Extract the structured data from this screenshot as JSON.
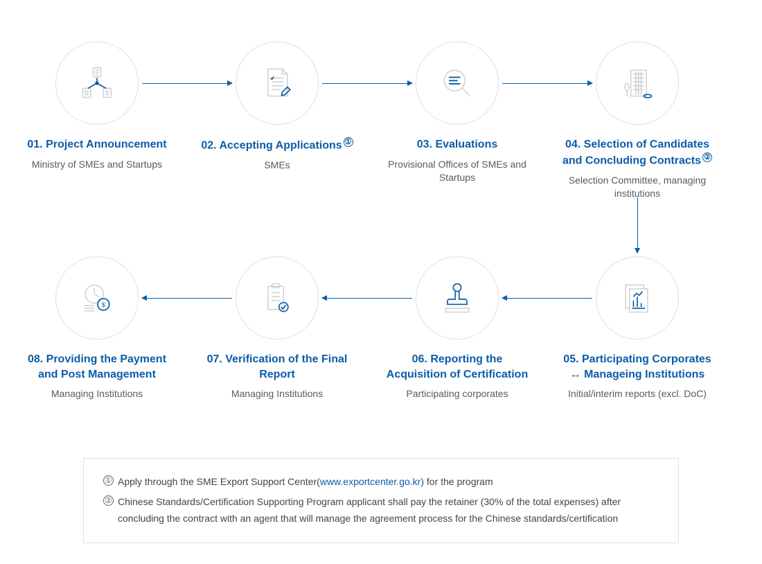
{
  "steps": [
    {
      "num": "01.",
      "title": "Project Announcement",
      "sub": "Ministry of SMEs and Startups",
      "note_ref": ""
    },
    {
      "num": "02.",
      "title": "Accepting Applications",
      "sub": "SMEs",
      "note_ref": "①"
    },
    {
      "num": "03.",
      "title": "Evaluations",
      "sub": "Provisional Offices of SMEs and Startups",
      "note_ref": ""
    },
    {
      "num": "04.",
      "title": "Selection of Candidates and Concluding Contracts",
      "sub": "Selection Committee, managing institutions",
      "note_ref": "②"
    },
    {
      "num": "05.",
      "title": "Participating Corporates ↔ Manageing Institutions",
      "sub": "Initial/interim reports (excl. DoC)",
      "note_ref": ""
    },
    {
      "num": "06.",
      "title": "Reporting the Acquisition of Certification",
      "sub": "Participating corporates",
      "note_ref": ""
    },
    {
      "num": "07.",
      "title": "Verification of the Final Report",
      "sub": "Managing Institutions",
      "note_ref": ""
    },
    {
      "num": "08.",
      "title": "Providing the Payment and Post Management",
      "sub": "Managing Institutions",
      "note_ref": ""
    }
  ],
  "notes": {
    "n1_marker": "①",
    "n1_pre": "Apply through the SME Export Support Center(",
    "n1_link": "www.exportcenter.go.kr",
    "n1_post": ") for the program",
    "n2_marker": "②",
    "n2_text": "Chinese Standards/Certification Supporting Program applicant shall pay the retainer (30% of the total expenses) after concluding the contract with an agent that will manage the agreement process for the Chinese standards/certification"
  },
  "colors": {
    "accent": "#0b5ca8",
    "icon_grey": "#cfcfcf",
    "text_grey": "#5a5a5a"
  }
}
